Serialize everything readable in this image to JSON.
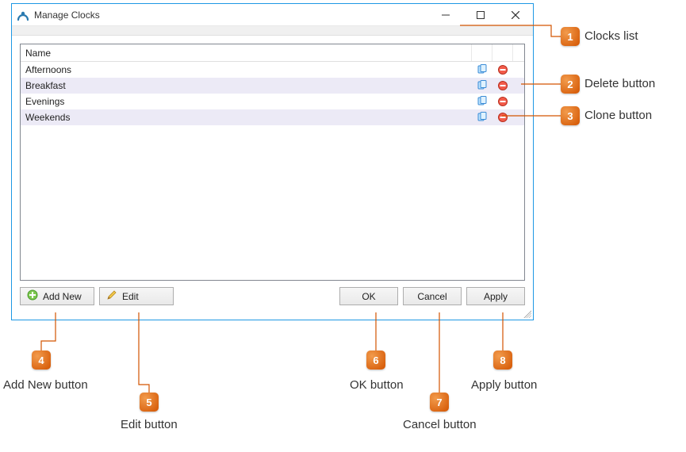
{
  "window": {
    "title": "Manage Clocks"
  },
  "list": {
    "header": "Name",
    "rows": [
      {
        "name": "Afternoons"
      },
      {
        "name": "Breakfast"
      },
      {
        "name": "Evenings"
      },
      {
        "name": "Weekends"
      }
    ]
  },
  "buttons": {
    "add_new": "Add New",
    "edit": "Edit",
    "ok": "OK",
    "cancel": "Cancel",
    "apply": "Apply"
  },
  "callouts": {
    "1": "Clocks list",
    "2": "Delete button",
    "3": "Clone button",
    "4": "Add New button",
    "5": "Edit button",
    "6": "OK button",
    "7": "Cancel button",
    "8": "Apply button"
  },
  "badges": {
    "1": "1",
    "2": "2",
    "3": "3",
    "4": "4",
    "5": "5",
    "6": "6",
    "7": "7",
    "8": "8"
  }
}
